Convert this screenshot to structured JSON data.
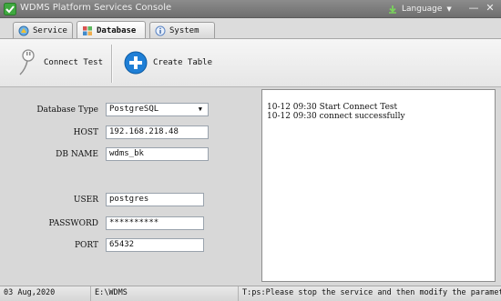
{
  "window": {
    "title": "WDMS Platform Services Console",
    "language_label": "Language",
    "minimize_glyph": "—",
    "close_glyph": "✕"
  },
  "tabs": [
    {
      "label": "Service",
      "icon": "service-icon",
      "active": false
    },
    {
      "label": "Database",
      "icon": "database-icon",
      "active": true
    },
    {
      "label": "System",
      "icon": "info-icon",
      "active": false
    }
  ],
  "toolbar": {
    "connect_test_label": "Connect Test",
    "create_table_label": "Create Table"
  },
  "form": {
    "database_type_label": "Database Type",
    "database_type_value": "PostgreSQL",
    "host_label": "HOST",
    "host_value": "192.168.218.48",
    "db_name_label": "DB NAME",
    "db_name_value": "wdms_bk",
    "user_label": "USER",
    "user_value": "postgres",
    "password_label": "PASSWORD",
    "password_value": "**********",
    "port_label": "PORT",
    "port_value": "65432"
  },
  "log": {
    "lines": [
      "10-12 09:30 Start Connect Test",
      "10-12 09:30 connect successfully"
    ]
  },
  "statusbar": {
    "date": "03 Aug,2020",
    "path": "E:\\WDMS",
    "tip": "T:ps:Please stop the service and then modify the parameters"
  },
  "colors": {
    "titlebar": "#7a7a7a",
    "plus_button": "#1f7fd6",
    "app_icon": "#3fa83f"
  }
}
